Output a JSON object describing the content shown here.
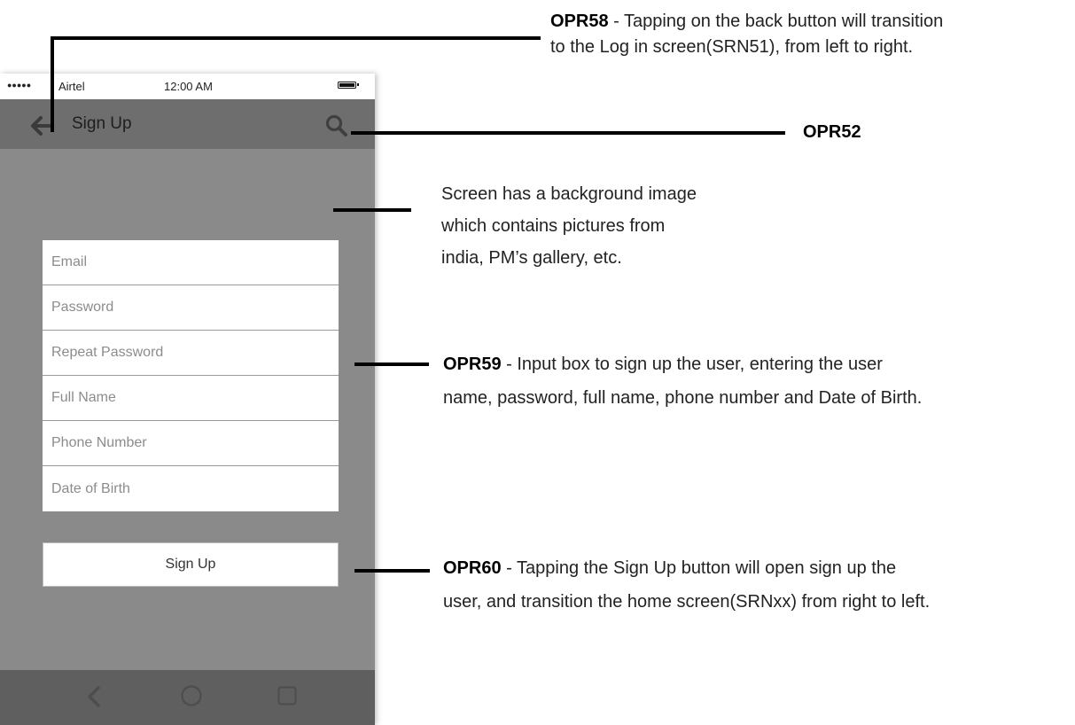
{
  "phone": {
    "status_bar": {
      "signal": "●●●●●",
      "carrier": "Airtel",
      "time": "12:00 AM"
    },
    "app_bar": {
      "title": "Sign Up",
      "back_icon": "back-arrow-icon",
      "search_icon": "search-icon"
    },
    "form": {
      "fields": [
        {
          "placeholder": "Email"
        },
        {
          "placeholder": "Password"
        },
        {
          "placeholder": "Repeat Password"
        },
        {
          "placeholder": "Full Name"
        },
        {
          "placeholder": "Phone Number"
        },
        {
          "placeholder": "Date of Birth"
        }
      ],
      "submit_label": "Sign Up"
    },
    "nav_bar": {
      "icons": [
        "back-triangle-icon",
        "home-circle-icon",
        "recent-apps-icon"
      ]
    }
  },
  "annotations": {
    "opr58": {
      "code": "OPR58",
      "line1": " - Tapping on the back button will transition",
      "line2": "to the Log in screen(SRN51), from left to right."
    },
    "opr52": {
      "code": "OPR52"
    },
    "background": {
      "line1": "Screen has a background image",
      "line2": "which contains pictures from",
      "line3": "india, PM’s gallery, etc."
    },
    "opr59": {
      "code": "OPR59",
      "line1": " - Input box to sign up the user, entering the user",
      "line2": "name, password, full name, phone number and Date of Birth."
    },
    "opr60": {
      "code": "OPR60",
      "line1": " - Tapping the Sign Up button will open sign up the",
      "line2": "user, and transition the home screen(SRNxx) from right to left."
    }
  },
  "colors": {
    "screen_bg": "#8a8a8a",
    "app_bar_bg": "#6e6e6e",
    "nav_bar_bg": "#5f5f5f",
    "leader_lines": "#000000"
  }
}
